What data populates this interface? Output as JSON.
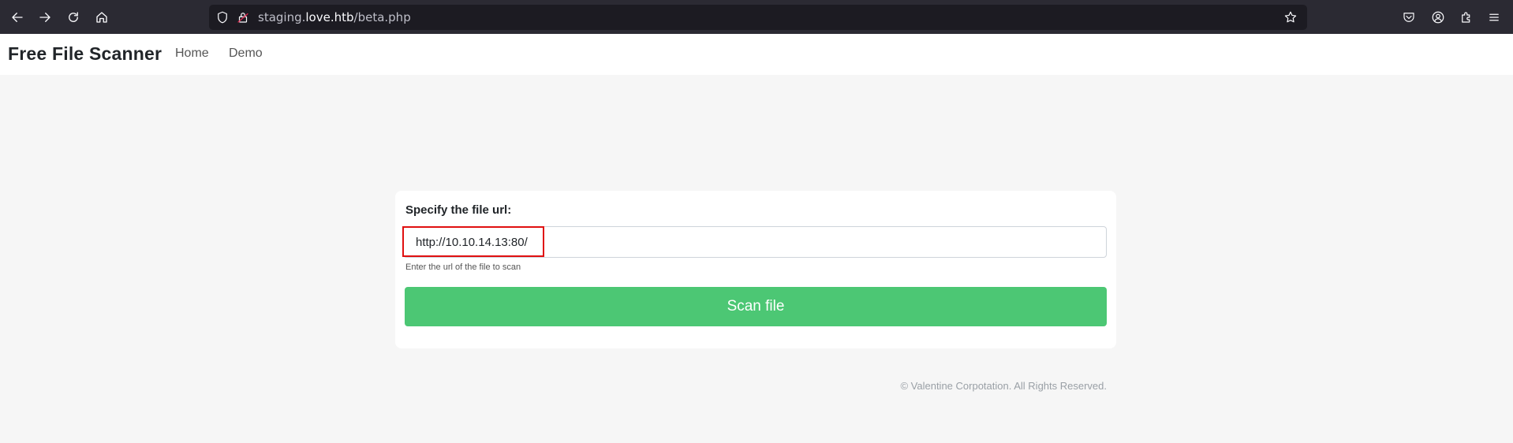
{
  "browser": {
    "url_prefix": "staging.",
    "url_domain": "love.htb",
    "url_path": "/beta.php"
  },
  "nav": {
    "brand": "Free File Scanner",
    "links": [
      "Home",
      "Demo"
    ]
  },
  "form": {
    "label": "Specify the file url:",
    "input_value": "http://10.10.14.13:80/",
    "help_text": "Enter the url of the file to scan",
    "button_label": "Scan file"
  },
  "footer": {
    "text": "© Valentine Corpotation. All Rights Reserved."
  },
  "colors": {
    "button": "#4cc774",
    "highlight": "#e01010",
    "chrome": "#2b2a33"
  },
  "icons": [
    "back-icon",
    "forward-icon",
    "reload-icon",
    "home-icon",
    "shield-icon",
    "lock-icon",
    "star-icon",
    "pocket-icon",
    "account-icon",
    "extensions-icon",
    "menu-icon"
  ]
}
